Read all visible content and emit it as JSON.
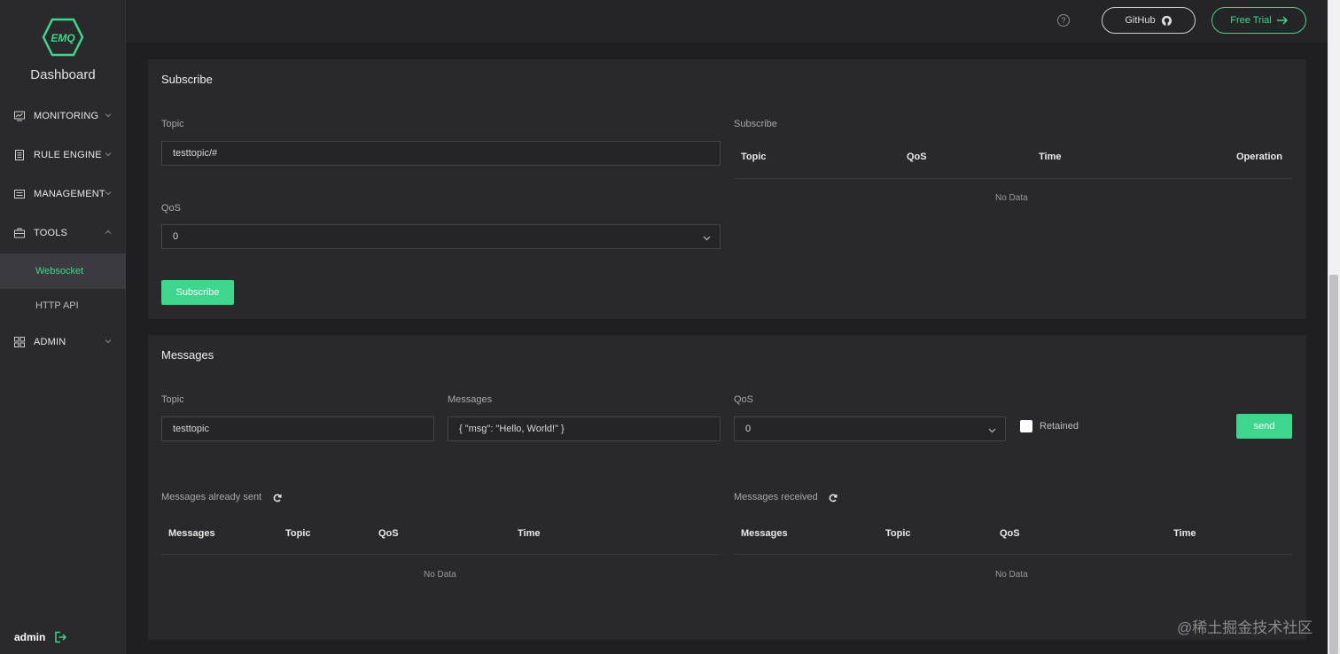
{
  "sidebar": {
    "logo_text": "EMQ",
    "brand": "Dashboard",
    "items": [
      {
        "label": "MONITORING"
      },
      {
        "label": "RULE ENGINE"
      },
      {
        "label": "MANAGEMENT"
      },
      {
        "label": "TOOLS"
      },
      {
        "label": "ADMIN"
      }
    ],
    "tools_sub": [
      {
        "label": "Websocket"
      },
      {
        "label": "HTTP API"
      }
    ],
    "user": "admin"
  },
  "header": {
    "help": "?",
    "github_label": "GitHub",
    "trial_label": "Free Trial"
  },
  "subscribe": {
    "title": "Subscribe",
    "topic_label": "Topic",
    "topic_value": "testtopic/#",
    "qos_label": "QoS",
    "qos_value": "0",
    "button": "Subscribe",
    "table_label": "Subscribe",
    "columns": [
      "Topic",
      "QoS",
      "Time",
      "Operation"
    ],
    "no_data": "No Data"
  },
  "messages": {
    "title": "Messages",
    "topic_label": "Topic",
    "topic_value": "testtopic",
    "message_label": "Messages",
    "message_value": "{ \"msg\": \"Hello, World!\" }",
    "qos_label": "QoS",
    "qos_value": "0",
    "retained_label": "Retained",
    "send_button": "send",
    "sent_label": "Messages already sent",
    "sent_columns": [
      "Messages",
      "Topic",
      "QoS",
      "Time"
    ],
    "sent_no_data": "No Data",
    "received_label": "Messages received",
    "received_columns": [
      "Messages",
      "Topic",
      "QoS",
      "Time"
    ],
    "received_no_data": "No Data"
  },
  "watermark": "@稀土掘金技术社区",
  "colors": {
    "accent": "#3dd68c",
    "background": "#1f1f22",
    "card": "#29292c",
    "sidebar": "#2a2a2d"
  }
}
